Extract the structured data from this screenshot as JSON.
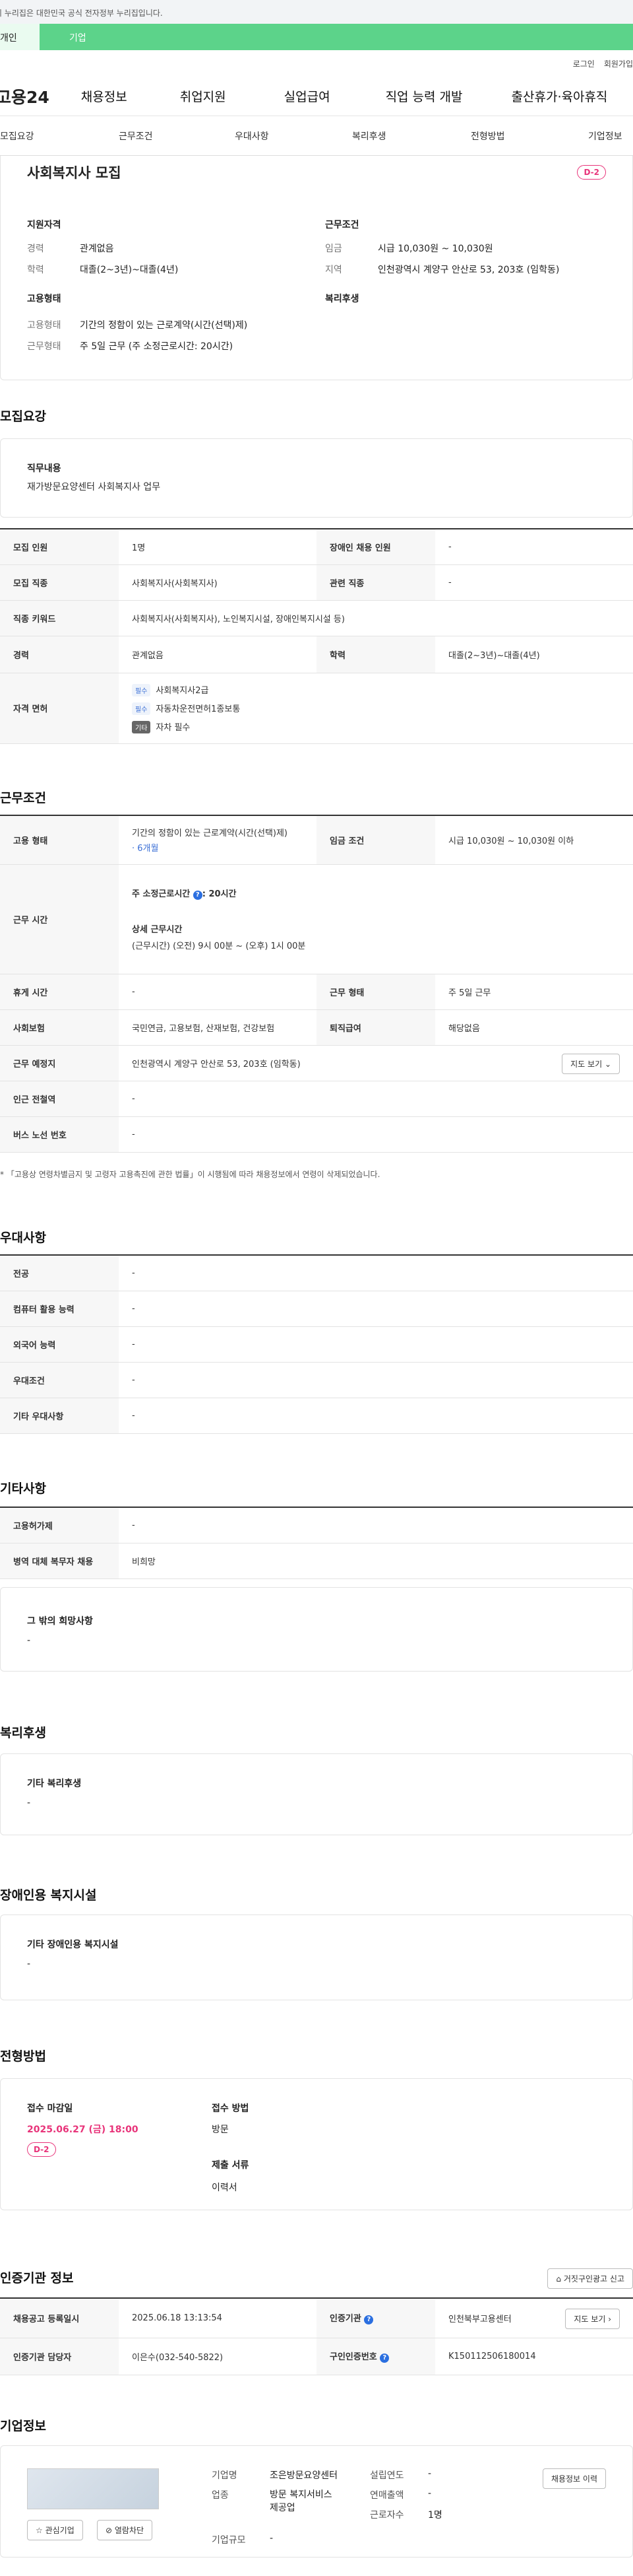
{
  "gov_banner": "이 누리집은 대한민국 공식 전자정부 누리집입니다.",
  "top_tabs": [
    "개인",
    "기업"
  ],
  "util": [
    "로그인",
    "회원가입"
  ],
  "logo": "고용24",
  "gnb": [
    "채용정보",
    "취업지원",
    "실업급여",
    "직업 능력 개발",
    "출산휴가·육아휴직"
  ],
  "snb": [
    "모집요강",
    "근무조건",
    "우대사항",
    "복리후생",
    "전형방법",
    "기업정보"
  ],
  "summary": {
    "title": "사회복지사 모집",
    "dday": "D-2",
    "qual_title": "지원자격",
    "qual": [
      {
        "k": "경력",
        "v": "관계없음"
      },
      {
        "k": "학력",
        "v": "대졸(2~3년)~대졸(4년)"
      }
    ],
    "cond_title": "근무조건",
    "cond": [
      {
        "k": "임금",
        "v": "시급 10,030원 ~ 10,030원"
      },
      {
        "k": "지역",
        "v": "인천광역시 계양구 안산로 53, 203호 (임학동)"
      }
    ],
    "type_title": "고용형태",
    "type": [
      {
        "k": "고용형태",
        "v": "기간의 정함이 있는 근로계약(시간(선택)제)"
      },
      {
        "k": "근무형태",
        "v": "주 5일 근무 (주 소정근로시간: 20시간)"
      }
    ],
    "welfare_title": "복리후생"
  },
  "recruit": {
    "title": "모집요강",
    "job_label": "직무내용",
    "job_value": "재가방문요양센터 사회복지사 업무",
    "rows": {
      "headcount_h": "모집 인원",
      "headcount": "1명",
      "disabled_h": "장애인 채용 인원",
      "disabled": "-",
      "job_h": "모집 직종",
      "job": "사회복지사(사회복지사)",
      "related_h": "관련 직종",
      "related": "-",
      "keyword_h": "직종 키워드",
      "keyword": "사회복지사(사회복지사), 노인복지시설, 장애인복지시설 등)",
      "career_h": "경력",
      "career": "관계없음",
      "edu_h": "학력",
      "edu": "대졸(2~3년)~대졸(4년)",
      "license_h": "자격 면허"
    },
    "licenses": [
      {
        "tag": "필수",
        "text": "사회복지사2급"
      },
      {
        "tag": "필수",
        "text": "자동차운전면허1종보통"
      },
      {
        "tag": "기타",
        "text": "자차 필수"
      }
    ]
  },
  "work": {
    "title": "근무조건",
    "emp_h": "고용 형태",
    "emp": "기간의 정함이 있는 근로계약(시간(선택)제)",
    "emp_period": "· 6개월",
    "wage_h": "임금 조건",
    "wage": "시급 10,030원 ~ 10,030원 이하",
    "time_h": "근무 시간",
    "time_main": "주 소정근로시간",
    "time_hours": ": 20시간",
    "time_detail_label": "상세 근무시간",
    "time_detail": "(근무시간) (오전) 9시 00분 ~ (오후) 1시 00분",
    "rest_h": "휴게 시간",
    "rest": "-",
    "form_h": "근무 형태",
    "form": "주 5일 근무",
    "ins_h": "사회보험",
    "ins": "국민연금, 고용보험, 산재보험, 건강보험",
    "retire_h": "퇴직급여",
    "retire": "해당없음",
    "place_h": "근무 예정지",
    "place": "인천광역시 계양구 안산로 53, 203호 (임학동)",
    "map_btn": "지도 보기",
    "station_h": "인근 전철역",
    "station": "-",
    "bus_h": "버스 노선 번호",
    "bus": "-",
    "note": "「고용상 연령차별금지 및 고령자 고용촉진에 관한 법률」이 시행됨에 따라 채용정보에서 연령이 삭제되었습니다."
  },
  "pref": {
    "title": "우대사항",
    "rows": [
      {
        "h": "전공",
        "v": "-"
      },
      {
        "h": "컴퓨터 활용 능력",
        "v": "-"
      },
      {
        "h": "외국어 능력",
        "v": "-"
      },
      {
        "h": "우대조건",
        "v": "-"
      },
      {
        "h": "기타 우대사항",
        "v": "-"
      }
    ]
  },
  "etc": {
    "title": "기타사항",
    "rows": [
      {
        "h": "고용허가제",
        "v": "-"
      },
      {
        "h": "병역 대체 복무자 채용",
        "v": "비희망"
      }
    ],
    "other_label": "그 밖의 희망사항",
    "other": "-"
  },
  "welfare": {
    "title": "복리후생",
    "label": "기타 복리후생",
    "value": "-"
  },
  "disabled_fac": {
    "title": "장애인용 복지시설",
    "label": "기타 장애인용 복지시설",
    "value": "-"
  },
  "process": {
    "title": "전형방법",
    "deadline_label": "접수 마감일",
    "deadline": "2025.06.27 (금) 18:00",
    "dday": "D-2",
    "method_label": "접수 방법",
    "method": "방문",
    "docs_label": "제출 서류",
    "docs": "이력서"
  },
  "cert": {
    "title": "인증기관 정보",
    "report_btn": "거짓구인광고 신고",
    "reg_h": "채용공고 등록일시",
    "reg": "2025.06.18 13:13:54",
    "org_h": "인증기관",
    "org": "인천북부고용센터",
    "map_btn": "지도 보기",
    "mgr_h": "인증기관 담당자",
    "mgr": "이은수(032-540-5822)",
    "no_h": "구인인증번호",
    "no": "K150112506180014"
  },
  "company": {
    "title": "기업정보",
    "fav_btn": "관심기업",
    "block_btn": "열람차단",
    "history_btn": "채용정보 이력",
    "name_h": "기업명",
    "name": "조은방문요양센터",
    "year_h": "설립연도",
    "year": "-",
    "biz_h": "업종",
    "biz": "방문 복지서비스 제공업",
    "sales_h": "연매출액",
    "sales": "-",
    "emp_h": "근로자수",
    "emp": "1명",
    "size_h": "기업규모",
    "size": "-"
  }
}
